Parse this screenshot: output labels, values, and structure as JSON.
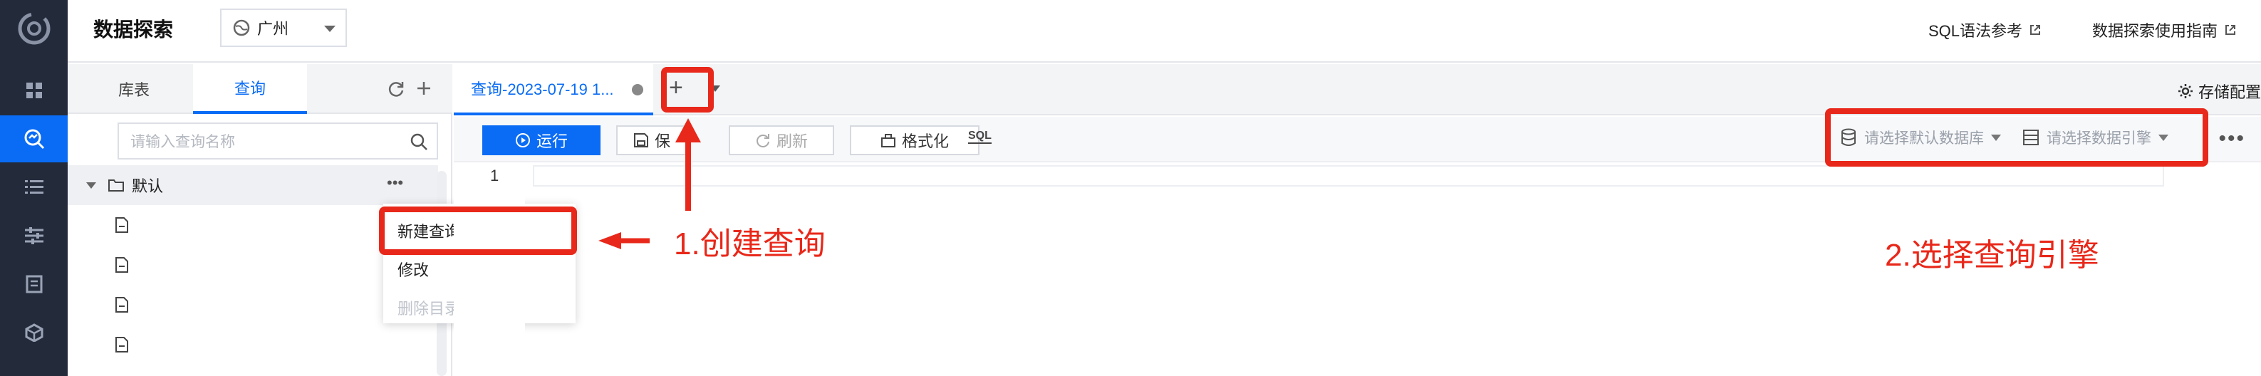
{
  "app": {
    "title": "数据探索",
    "region": "广州"
  },
  "header_links": {
    "sql_ref": "SQL语法参考",
    "guide": "数据探索使用指南"
  },
  "sidebar": {
    "tabs": [
      "库表",
      "查询"
    ],
    "active_tab": "查询",
    "search_placeholder": "请输入查询名称",
    "folder": "默认",
    "more": "•••"
  },
  "context_menu": {
    "items": [
      "新建查询",
      "修改",
      "删除目录"
    ]
  },
  "editor": {
    "tab_label": "查询-2023-07-19 1...",
    "add_tab": "+",
    "storage_config": "存储配置",
    "toolbar": {
      "run": "运行",
      "save": "保",
      "refresh": "刷新",
      "format": "格式化",
      "sql_icon_text": "SQL"
    },
    "db_placeholder": "请选择默认数据库",
    "engine_placeholder": "请选择数据引擎",
    "line_number": "1",
    "more": "•••"
  },
  "annotations": {
    "step1": "1.创建查询",
    "step2": "2.选择查询引擎"
  },
  "colors": {
    "accent": "#0a6cf5",
    "annotation": "#e8281a",
    "nav_bg": "#232b3b"
  }
}
